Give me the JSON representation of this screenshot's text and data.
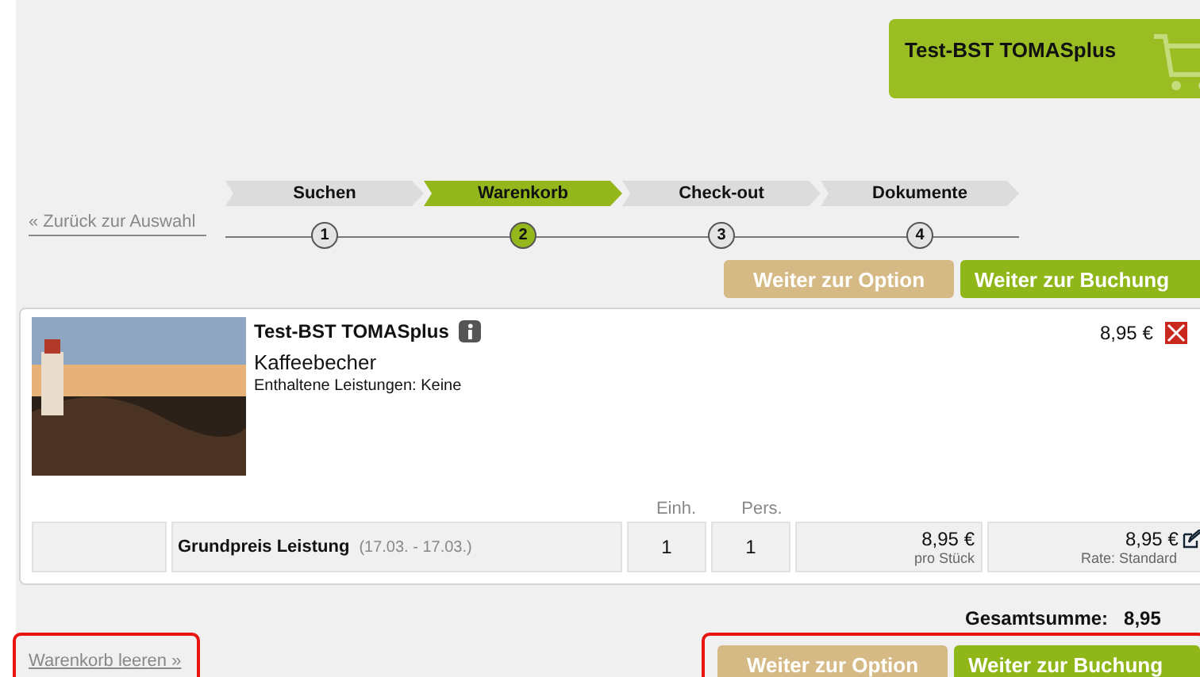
{
  "cart_badge": {
    "title": "Test-BST TOMASplus"
  },
  "back_link": "« Zurück zur Auswahl",
  "steps": [
    {
      "label": "Suchen",
      "number": "1",
      "selected": false
    },
    {
      "label": "Warenkorb",
      "number": "2",
      "selected": true
    },
    {
      "label": "Check-out",
      "number": "3",
      "selected": false
    },
    {
      "label": "Dokumente",
      "number": "4",
      "selected": false
    }
  ],
  "top_buttons": [
    {
      "label": "Weiter zur Option",
      "kind": "option"
    },
    {
      "label": "Weiter zur Buchung",
      "kind": "booking"
    }
  ],
  "item": {
    "title": "Test-BST TOMASplus",
    "name": "Kaffeebecher",
    "included": "Enthaltene Leistungen: Keine",
    "price": "8,95 €",
    "columns": [
      "Einh.",
      "Pers."
    ],
    "row": {
      "label": "Grundpreis Leistung",
      "dates": "(17.03. - 17.03.)",
      "units": "1",
      "persons": "1",
      "unit_price": "8,95 €",
      "unit_note": "pro Stück",
      "total": "8,95 €",
      "rate": "Rate: Standard"
    }
  },
  "total": {
    "label": "Gesamtsumme:",
    "value": "8,95"
  },
  "clear_link": {
    "label": "Warenkorb leeren »",
    "highlighted": true
  },
  "bottom_buttons": {
    "highlighted": true,
    "items": [
      {
        "label": "Weiter zur Option",
        "kind": "option"
      },
      {
        "label": "Weiter zur Buchung",
        "kind": "booking"
      }
    ]
  }
}
